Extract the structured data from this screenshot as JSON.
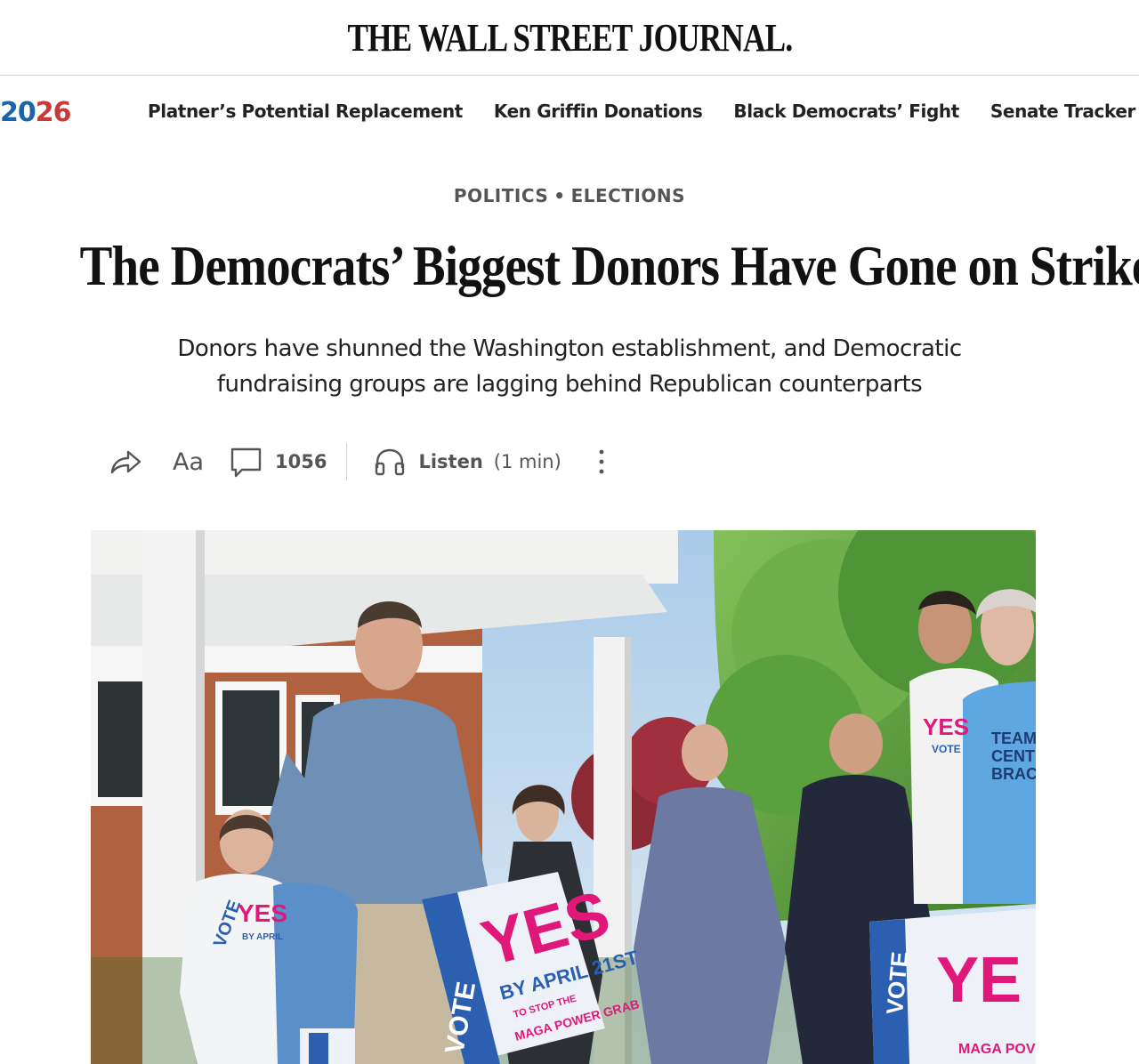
{
  "masthead": {
    "title": "THE WALL STREET JOURNAL."
  },
  "nav": {
    "brand": {
      "digits": [
        "2",
        "0",
        "2",
        "6"
      ]
    },
    "links": [
      "Platner’s Potential Replacement",
      "Ken Griffin Donations",
      "Black Democrats’ Fight",
      "Senate Tracker"
    ]
  },
  "article": {
    "kicker": {
      "section": "POLITICS",
      "subsection": "ELECTIONS",
      "separator": "•"
    },
    "headline": "The Democrats’ Biggest Donors Have Gone on Strike",
    "dek": [
      "Donors have shunned the Washington establishment, and Democratic",
      "fundraising groups are lagging behind Republican counterparts"
    ]
  },
  "toolbar": {
    "font_label": "Aa",
    "comment_count": "1056",
    "listen_label": "Listen",
    "duration": "(1 min)",
    "icons": [
      "share-icon",
      "comment-icon",
      "headphones-icon",
      "more-vertical-icon"
    ]
  },
  "photo": {
    "signs": {
      "big_word": "YES",
      "side_word": "VOTE",
      "date_line": "BY APRIL 21ST",
      "small_line1": "TO STOP THE",
      "small_line2": "MAGA POWER GRAB",
      "right_fragment": "YE",
      "right_bottom": "MAGA POV"
    },
    "shirts": {
      "left": "VOTE",
      "left_yes": "YES",
      "left_small": "BY APRIL",
      "right_yes": "YES",
      "right_vote": "VOTE",
      "team": [
        "TEAM",
        "CENT",
        "BRAC"
      ]
    }
  },
  "colors": {
    "brand_blue": "#1c63a8",
    "brand_red": "#c83a3a",
    "sign_pink": "#e0187a",
    "sign_blue": "#2b5fb0",
    "sky": "#bcd6ee",
    "foliage": "#5e9e3e",
    "brick": "#a5573d"
  }
}
